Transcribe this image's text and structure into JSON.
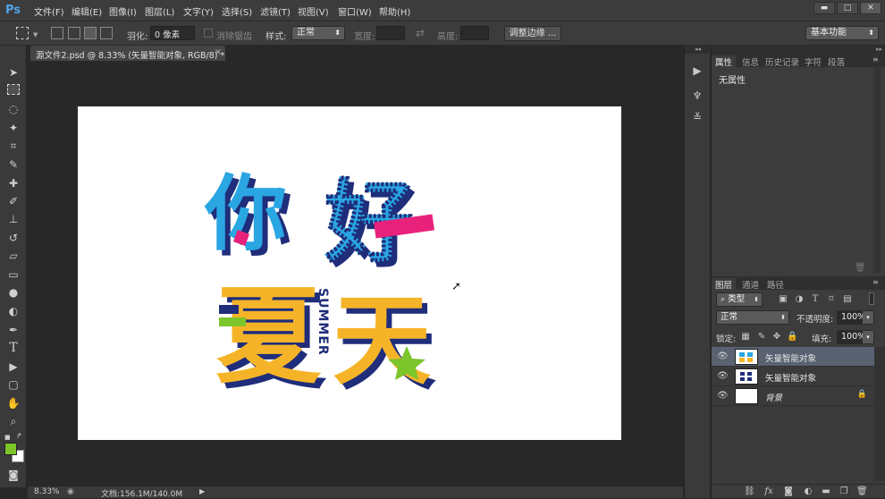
{
  "app": {
    "logo": "Ps",
    "accent": "#4fa3e8"
  },
  "menu": [
    "文件(F)",
    "编辑(E)",
    "图像(I)",
    "图层(L)",
    "文字(Y)",
    "选择(S)",
    "滤镜(T)",
    "视图(V)",
    "窗口(W)",
    "帮助(H)"
  ],
  "window_controls": {
    "minimize": "▬",
    "maximize": "□",
    "close": "✕"
  },
  "options": {
    "feather_label": "羽化:",
    "feather_value": "0 像素",
    "antialias_label": "消除锯齿",
    "style_label": "样式:",
    "style_value": "正常",
    "width_label": "宽度:",
    "height_label": "高度:",
    "refine_button": "调整边缘 ...",
    "workspace": "基本功能"
  },
  "document": {
    "tab_title": "源文件2.psd @ 8.33% (矢量智能对象, RGB/8) *",
    "close": "×"
  },
  "artwork": {
    "row1": [
      "你",
      "好"
    ],
    "row2": [
      "夏",
      "天"
    ],
    "vertical_text": "SUMMER",
    "colors": {
      "blue": "#2aa6e3",
      "navy": "#1f2d7a",
      "yellow": "#f5b428",
      "pink": "#e8217a",
      "green": "#7cc52b"
    }
  },
  "status": {
    "zoom": "8.33%",
    "doc_info": "文档:156.1M/140.0M"
  },
  "properties_panel": {
    "tabs": [
      "属性",
      "信息",
      "历史记录",
      "字符",
      "段落"
    ],
    "active_tab": 0,
    "content": "无属性"
  },
  "layers_panel": {
    "tabs": [
      "图层",
      "通道",
      "路径"
    ],
    "active_tab": 0,
    "filter_label": "类型",
    "blend_mode": "正常",
    "opacity_label": "不透明度:",
    "opacity_value": "100%",
    "lock_label": "锁定:",
    "fill_label": "填充:",
    "fill_value": "100%",
    "layers": [
      {
        "name": "矢量智能对象",
        "selected": true
      },
      {
        "name": "矢量智能对象",
        "selected": false
      },
      {
        "name": "背景",
        "selected": false,
        "locked": true
      }
    ],
    "footer_icons": [
      "link-icon",
      "fx-icon",
      "mask-icon",
      "adjustment-icon",
      "folder-icon",
      "new-layer-icon",
      "trash-icon"
    ],
    "fx_text": "fx"
  }
}
